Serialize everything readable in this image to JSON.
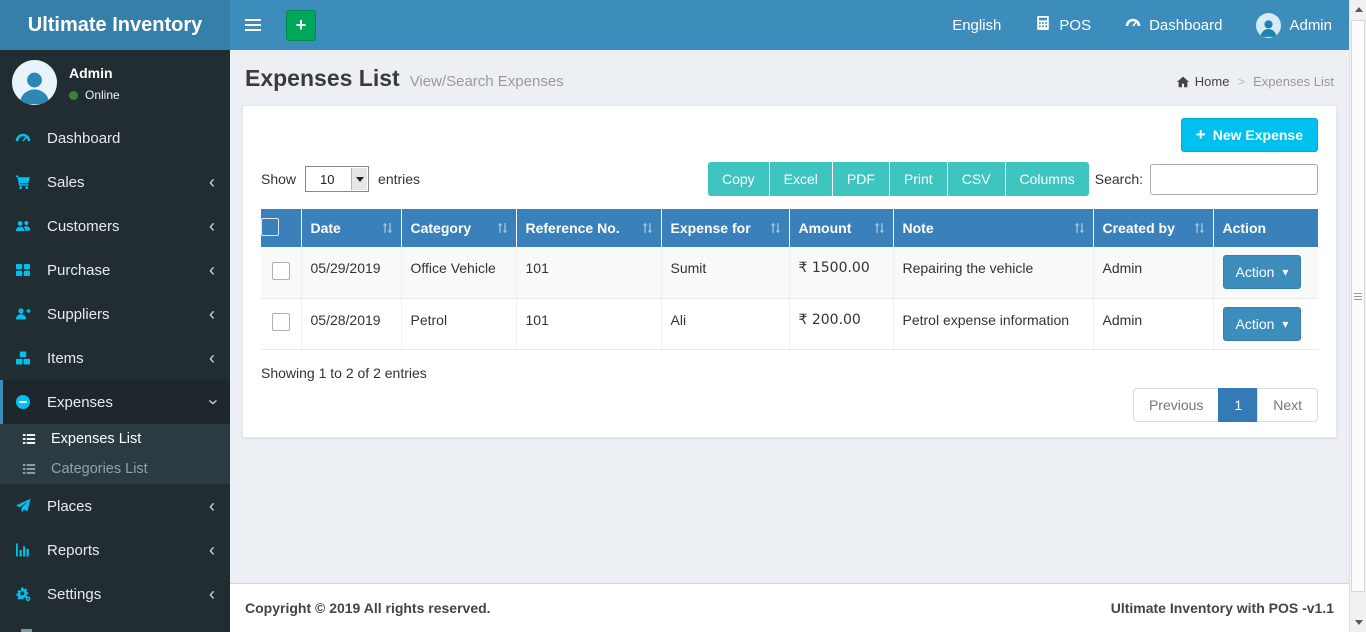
{
  "brand": "Ultimate Inventory",
  "navbar": {
    "items": [
      {
        "label": "English",
        "icon": null
      },
      {
        "label": "POS",
        "icon": "calculator-icon"
      },
      {
        "label": "Dashboard",
        "icon": "tachometer-icon"
      },
      {
        "label": "Admin",
        "icon": "user-avatar-icon"
      }
    ]
  },
  "sidebar": {
    "user": {
      "name": "Admin",
      "status": "Online"
    },
    "items": [
      {
        "label": "Dashboard",
        "icon": "tachometer-icon",
        "expandable": false
      },
      {
        "label": "Sales",
        "icon": "cart-icon",
        "expandable": true
      },
      {
        "label": "Customers",
        "icon": "users-icon",
        "expandable": true
      },
      {
        "label": "Purchase",
        "icon": "grid-icon",
        "expandable": true
      },
      {
        "label": "Suppliers",
        "icon": "user-plus-icon",
        "expandable": true
      },
      {
        "label": "Items",
        "icon": "cubes-icon",
        "expandable": true
      },
      {
        "label": "Expenses",
        "icon": "minus-circle-icon",
        "expandable": true,
        "expanded": true,
        "active": true
      },
      {
        "label": "Places",
        "icon": "paper-plane-icon",
        "expandable": true
      },
      {
        "label": "Reports",
        "icon": "bar-chart-icon",
        "expandable": true
      },
      {
        "label": "Settings",
        "icon": "gears-icon",
        "expandable": true
      }
    ],
    "submenu": [
      {
        "label": "Expenses List",
        "icon": "list-icon",
        "active": true
      },
      {
        "label": "Categories List",
        "icon": "list-icon",
        "active": false
      }
    ]
  },
  "header": {
    "title": "Expenses List",
    "subtitle": "View/Search Expenses"
  },
  "breadcrumb": {
    "home": "Home",
    "current": "Expenses List"
  },
  "toolbar": {
    "new_expense": "New Expense",
    "show_label": "Show",
    "page_length": "10",
    "entries_label": "entries",
    "export_buttons": [
      "Copy",
      "Excel",
      "PDF",
      "Print",
      "CSV",
      "Columns"
    ],
    "search_label": "Search:"
  },
  "table": {
    "columns": [
      "Date",
      "Category",
      "Reference No.",
      "Expense for",
      "Amount",
      "Note",
      "Created by",
      "Action"
    ],
    "rows": [
      {
        "date": "05/29/2019",
        "category": "Office Vehicle",
        "reference": "101",
        "expense_for": "Sumit",
        "amount": "₹ 1500.00",
        "note": "Repairing the vehicle",
        "created_by": "Admin",
        "action_label": "Action"
      },
      {
        "date": "05/28/2019",
        "category": "Petrol",
        "reference": "101",
        "expense_for": "Ali",
        "amount": "₹ 200.00",
        "note": "Petrol expense information",
        "created_by": "Admin",
        "action_label": "Action"
      }
    ],
    "summary": "Showing 1 to 2 of 2 entries"
  },
  "pagination": {
    "previous": "Previous",
    "current": "1",
    "next": "Next"
  },
  "footer": {
    "copyright": "Copyright © 2019 All rights reserved.",
    "version": "Ultimate Inventory with POS -v1.1"
  },
  "colors": {
    "navbar": "#3c8dbc",
    "logo_bg": "#367fa9",
    "sidebar_bg": "#222d32",
    "submenu_bg": "#2c3b41",
    "sidebar_icon": "#00c0ef",
    "table_header": "#3a80ba",
    "export_button": "#3fc5c0",
    "new_expense_button": "#00c0ef",
    "add_button": "#00a65a",
    "active_page": "#337ab7",
    "online_dot": "#3f7e43"
  }
}
